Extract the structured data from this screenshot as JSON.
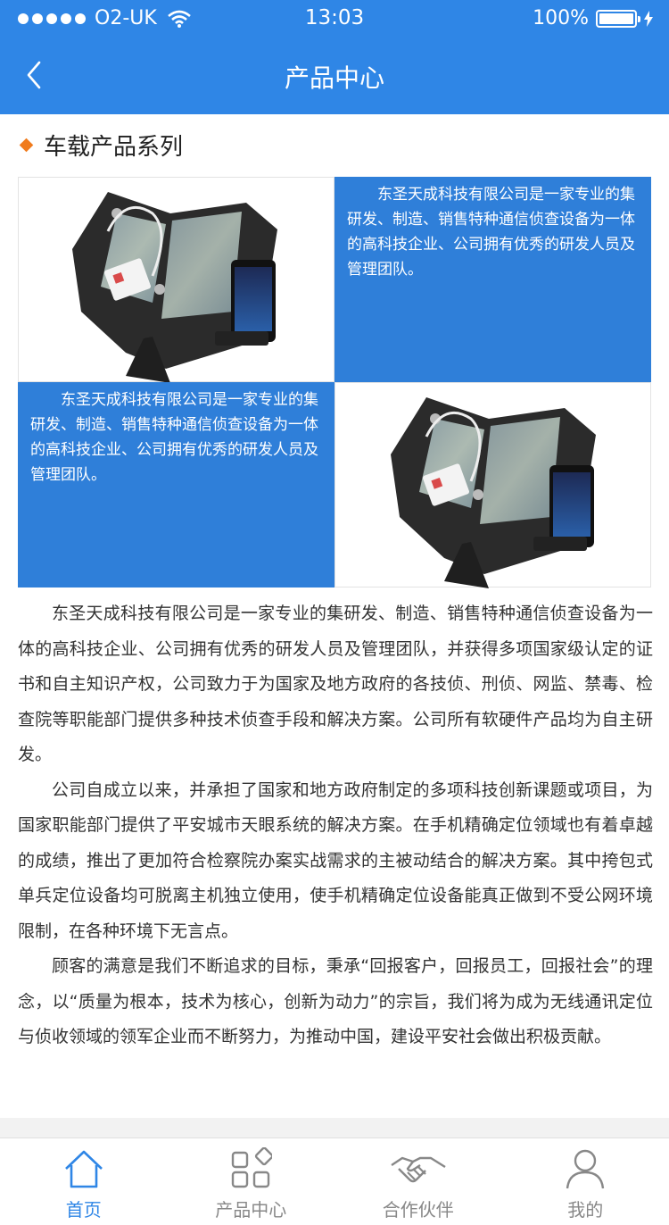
{
  "status_bar": {
    "carrier": "O2-UK",
    "time": "13:03",
    "battery": "100%"
  },
  "header": {
    "title": "产品中心",
    "back_icon": "chevron-left-icon"
  },
  "section": {
    "title": "车载产品系列"
  },
  "grid": {
    "blurb_1": "东圣天成科技有限公司是一家专业的集研发、制造、销售特种通信侦查设备为一体的高科技企业、公司拥有优秀的研发人员及管理团队。",
    "blurb_2": "东圣天成科技有限公司是一家专业的集研发、制造、销售特种通信侦查设备为一体的高科技企业、公司拥有优秀的研发人员及管理团队。"
  },
  "article": {
    "paragraphs": [
      "东圣天成科技有限公司是一家专业的集研发、制造、销售特种通信侦查设备为一体的高科技企业、公司拥有优秀的研发人员及管理团队，并获得多项国家级认定的证书和自主知识产权，公司致力于为国家及地方政府的各技侦、刑侦、网监、禁毒、检查院等职能部门提供多种技术侦查手段和解决方案。公司所有软硬件产品均为自主研发。",
      "公司自成立以来，并承担了国家和地方政府制定的多项科技创新课题或项目，为国家职能部门提供了平安城市天眼系统的解决方案。在手机精确定位领域也有着卓越的成绩，推出了更加符合检察院办案实战需求的主被动结合的解决方案。其中挎包式单兵定位设备均可脱离主机独立使用，使手机精确定位设备能真正做到不受公网环境限制，在各种环境下无言点。",
      "顾客的满意是我们不断追求的目标，秉承“回报客户，回报员工，回报社会”的理念，以“质量为根本，技术为核心，创新为动力”的宗旨，我们将为成为无线通讯定位与侦收领域的领军企业而不断努力，为推动中国，建设平安社会做出积极贡献。"
    ]
  },
  "tabbar": {
    "active_color": "#2f86e6",
    "inactive_color": "#888888",
    "tabs": [
      {
        "label": "首页",
        "icon": "home-icon",
        "active": true
      },
      {
        "label": "产品中心",
        "icon": "grid-icon",
        "active": false
      },
      {
        "label": "合作伙伴",
        "icon": "handshake-icon",
        "active": false
      },
      {
        "label": "我的",
        "icon": "user-icon",
        "active": false
      }
    ]
  },
  "colors": {
    "brand_blue": "#2f86e6",
    "accent_orange": "#f07b1d"
  }
}
